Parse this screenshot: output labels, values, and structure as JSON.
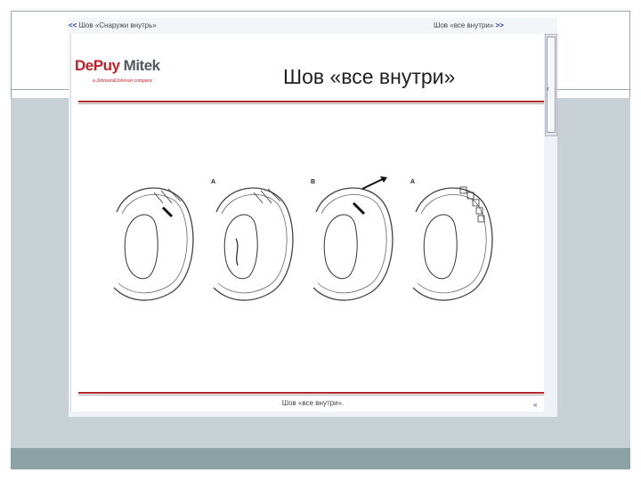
{
  "nav": {
    "prev_arrow": "<<",
    "prev_label": "Шов «Снаружи внутрь»",
    "next_label": "Шов «все внутри»",
    "next_arrow": ">>"
  },
  "logo": {
    "brand_part1": "DePuy",
    "brand_part2": "Mitek",
    "tagline": "a Johnson&Johnson company"
  },
  "slide": {
    "title": "Шов «все внутри»"
  },
  "figures": [
    {
      "letter": ""
    },
    {
      "letter": "A"
    },
    {
      "letter": "B"
    },
    {
      "letter": "A"
    }
  ],
  "footer": {
    "caption": "Шов «все внутри»."
  },
  "colors": {
    "accent_red": "#b3272b",
    "band": "#c7d1d5",
    "footer_bar": "#8ca3a5"
  }
}
